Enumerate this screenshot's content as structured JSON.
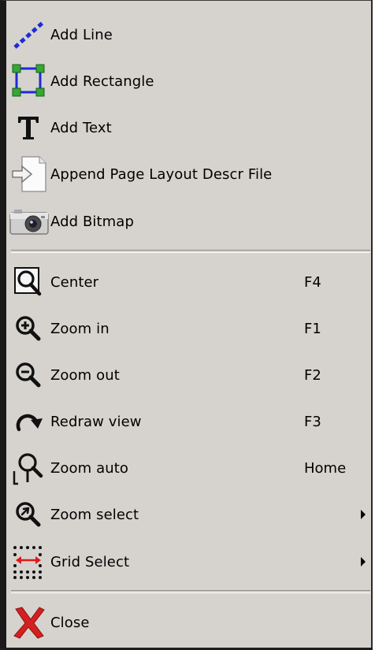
{
  "menu": {
    "items": [
      {
        "label": "Add Line",
        "icon": "add-line-icon"
      },
      {
        "label": "Add Rectangle",
        "icon": "add-rectangle-icon"
      },
      {
        "label": "Add Text",
        "icon": "add-text-icon"
      },
      {
        "label": "Append Page Layout Descr File",
        "icon": "append-file-icon"
      },
      {
        "label": "Add Bitmap",
        "icon": "camera-icon"
      },
      {
        "label": "Center",
        "shortcut": "F4",
        "icon": "center-icon"
      },
      {
        "label": "Zoom in",
        "shortcut": "F1",
        "icon": "zoom-in-icon"
      },
      {
        "label": "Zoom out",
        "shortcut": "F2",
        "icon": "zoom-out-icon"
      },
      {
        "label": "Redraw view",
        "shortcut": "F3",
        "icon": "redraw-icon"
      },
      {
        "label": "Zoom auto",
        "shortcut": "Home",
        "icon": "zoom-auto-icon"
      },
      {
        "label": "Zoom select",
        "icon": "zoom-select-icon",
        "submenu": true
      },
      {
        "label": "Grid Select",
        "icon": "grid-select-icon",
        "submenu": true
      },
      {
        "label": "Close",
        "icon": "close-icon"
      }
    ]
  },
  "colors": {
    "menu_bg": "#d6d3ce",
    "line_blue": "#1d2bd8",
    "handle_green": "#33a832",
    "close_red": "#d32020",
    "grid_arrow_red": "#e01818"
  }
}
